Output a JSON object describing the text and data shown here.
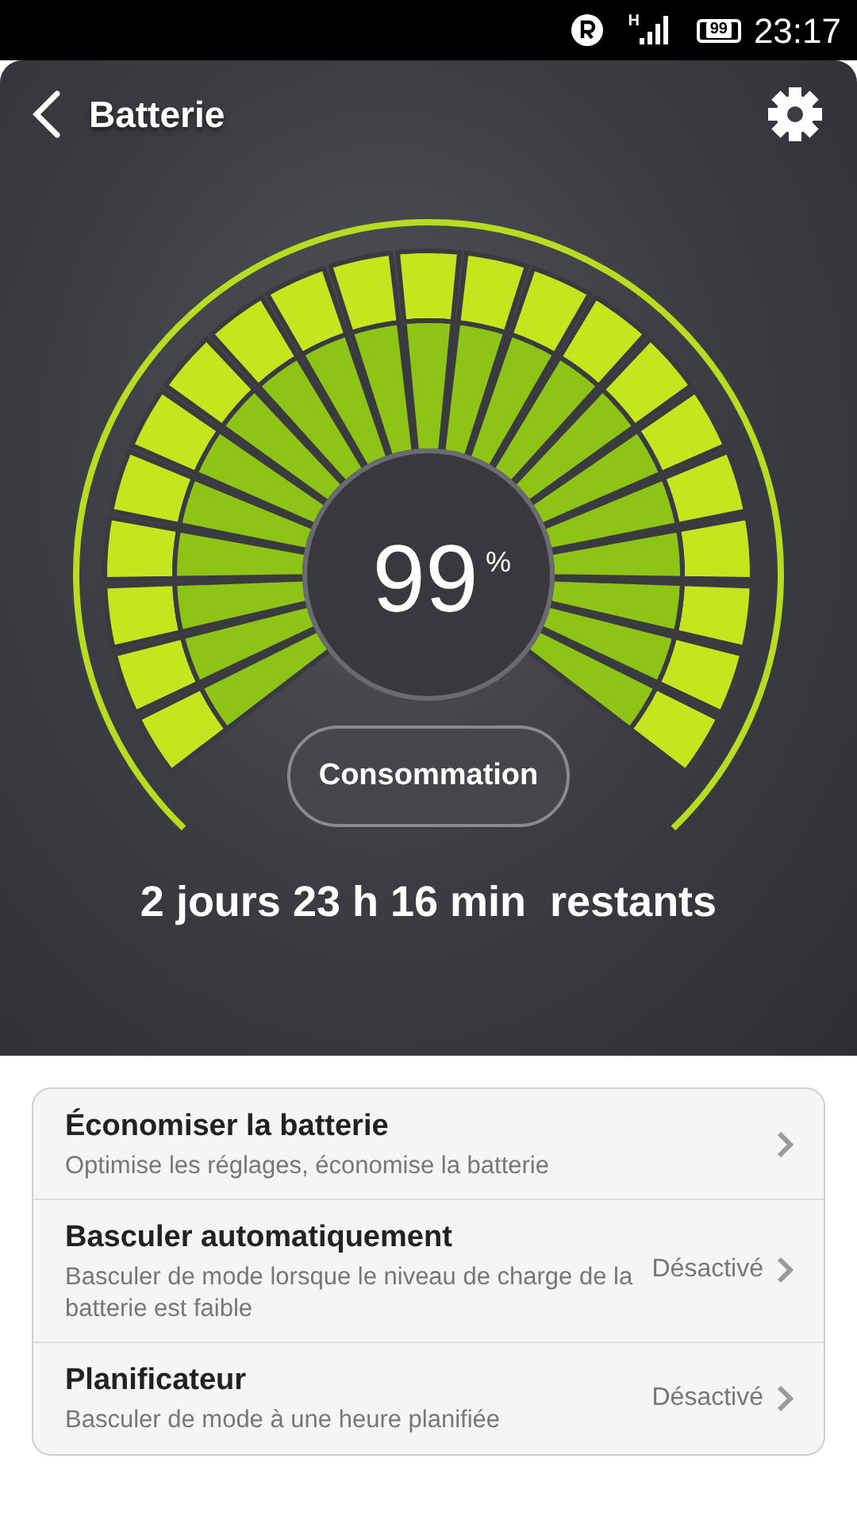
{
  "status_bar": {
    "network_type": "H",
    "battery": "99",
    "time": "23:17"
  },
  "header": {
    "title": "Batterie"
  },
  "gauge": {
    "value": "99",
    "unit": "%"
  },
  "consumption_button": {
    "label": "Consommation"
  },
  "remaining": "2 jours 23 h 16 min  restants",
  "settings": [
    {
      "title": "Économiser la batterie",
      "subtitle": "Optimise les réglages, économise la batterie"
    },
    {
      "title": "Basculer automatiquement",
      "subtitle": "Basculer de mode lorsque le niveau de charge de la batterie est faible",
      "value": "Désactivé"
    },
    {
      "title": "Planificateur",
      "subtitle": "Basculer de mode à une heure planifiée",
      "value": "Désactivé"
    }
  ]
}
